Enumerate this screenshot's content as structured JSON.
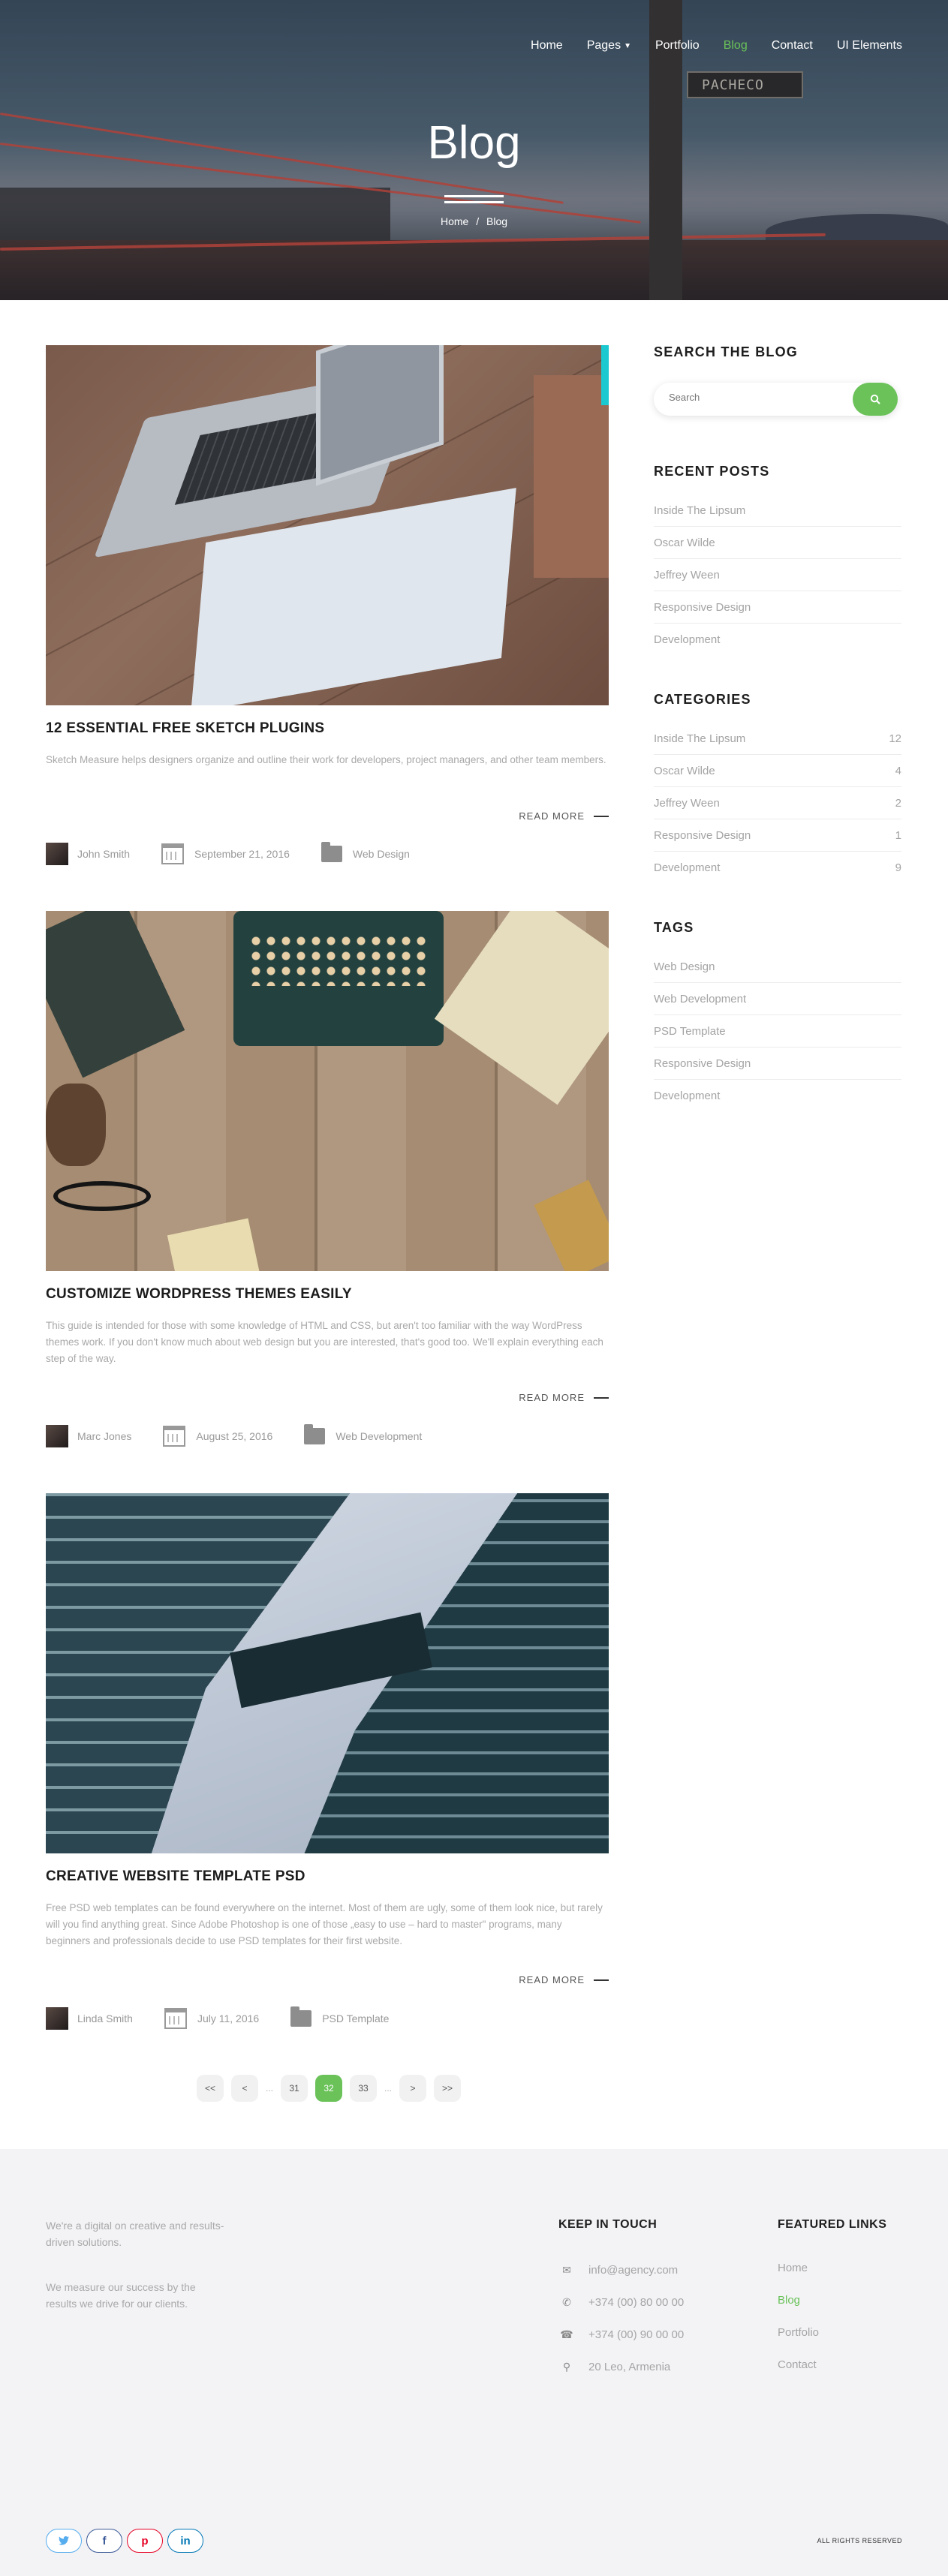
{
  "nav": {
    "items": [
      {
        "label": "Home"
      },
      {
        "label": "Pages"
      },
      {
        "label": "Portfolio"
      },
      {
        "label": "Blog"
      },
      {
        "label": "Contact"
      },
      {
        "label": "UI Elements"
      }
    ],
    "active": "Blog"
  },
  "hero": {
    "title": "Blog",
    "breadcrumb": [
      "Home",
      "/",
      "Blog"
    ],
    "street_sign": "PACHECO"
  },
  "posts": [
    {
      "title": "12 ESSENTIAL FREE SKETCH PLUGINS",
      "excerpt": "Sketch Measure helps designers organize and outline their work for developers, project managers, and other team members.",
      "read_more": "READ MORE",
      "author": "John Smith",
      "date": "September 21, 2016",
      "category": "Web Design"
    },
    {
      "title": "CUSTOMIZE WORDPRESS THEMES EASILY",
      "excerpt": "This guide is intended for those with some knowledge of HTML and CSS, but aren't too familiar with the way WordPress themes work. If you don't know much about web design but you are interested, that's good too. We'll explain everything each step of the way.",
      "read_more": "READ MORE",
      "author": "Marc Jones",
      "date": "August 25, 2016",
      "category": "Web Development"
    },
    {
      "title": "CREATIVE WEBSITE TEMPLATE PSD",
      "excerpt": "Free PSD web templates can be found everywhere on the internet. Most of them are ugly, some of them look nice, but rarely will you find anything great. Since Adobe Photoshop is one of those „easy to use – hard to master\" programs, many beginners and professionals decide to use PSD templates for their first website.",
      "read_more": "READ MORE",
      "author": "Linda Smith",
      "date": "July 11, 2016",
      "category": "PSD Template"
    }
  ],
  "pagination": {
    "first": "<<",
    "prev": "<",
    "dots": "...",
    "pages": [
      "31",
      "32",
      "33"
    ],
    "current": "32",
    "next": ">",
    "last": ">>"
  },
  "sidebar": {
    "search_title": "SEARCH THE BLOG",
    "search_placeholder": "Search",
    "recent_title": "RECENT POSTS",
    "recent": [
      "Inside The Lipsum",
      "Oscar Wilde",
      "Jeffrey Ween",
      "Responsive Design",
      "Development"
    ],
    "categories_title": "CATEGORIES",
    "categories": [
      {
        "name": "Inside The Lipsum",
        "count": "12"
      },
      {
        "name": "Oscar Wilde",
        "count": "4"
      },
      {
        "name": "Jeffrey Ween",
        "count": "2"
      },
      {
        "name": "Responsive Design",
        "count": "1"
      },
      {
        "name": "Development",
        "count": "9"
      }
    ],
    "tags_title": "TAGS",
    "tags": [
      "Web Design",
      "Web Development",
      "PSD Template",
      "Responsive Design",
      "Development"
    ]
  },
  "footer": {
    "about1": "We're a digital on creative and results-driven solutions.",
    "about2": "We measure our success by the results we drive for our clients.",
    "keep_title": "KEEP IN TOUCH",
    "contacts": [
      {
        "icon": "envelope-icon",
        "text": "info@agency.com"
      },
      {
        "icon": "phone-icon",
        "text": "+374 (00) 80 00 00"
      },
      {
        "icon": "fax-icon",
        "text": "+374 (00) 90 00 00"
      },
      {
        "icon": "map-pin-icon",
        "text": "20 Leo, Armenia"
      }
    ],
    "links_title": "FEATURED LINKS",
    "links": [
      "Home",
      "Blog",
      "Portfolio",
      "Contact"
    ],
    "active_link": "Blog",
    "social": [
      {
        "icon": "twitter-icon",
        "glyph": "🐦",
        "color": "#55acee"
      },
      {
        "icon": "facebook-icon",
        "glyph": "f",
        "color": "#3b5998"
      },
      {
        "icon": "pinterest-icon",
        "glyph": "p",
        "color": "#e60023"
      },
      {
        "icon": "linkedin-icon",
        "glyph": "in",
        "color": "#0077b5"
      }
    ],
    "rights": "ALL RIGHTS RESERVED"
  },
  "colors": {
    "accent": "#6ac259"
  }
}
